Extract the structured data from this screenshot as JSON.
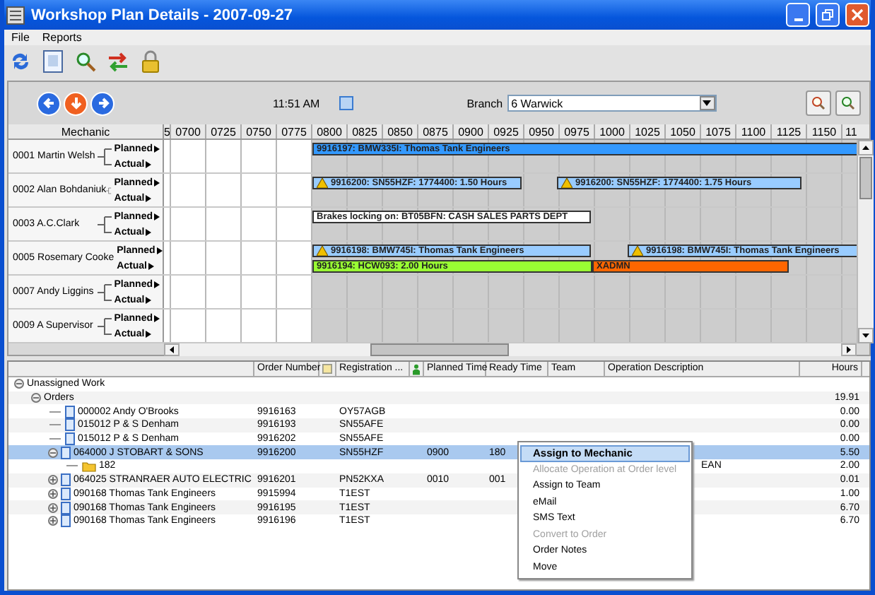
{
  "window": {
    "title": "Workshop Plan Details - 2007-09-27"
  },
  "menu": [
    "File",
    "Reports"
  ],
  "planner": {
    "time": "11:51 AM",
    "branch_label": "Branch",
    "branch": "6 Warwick",
    "mechanic_header": "Mechanic",
    "ticks": [
      "5",
      "0700",
      "0725",
      "0750",
      "0775",
      "0800",
      "0825",
      "0850",
      "0875",
      "0900",
      "0925",
      "0950",
      "0975",
      "1000",
      "1025",
      "1050",
      "1075",
      "1100",
      "1125",
      "1150",
      "11"
    ],
    "mechanics": [
      {
        "name": "0001 Martin Welsh",
        "lanes": [
          {
            "label": "Planned",
            "bars": [
              {
                "text": "9916197: BMW335I: Thomas Tank Engineers",
                "color": "#3399ff",
                "warning": false
              }
            ]
          },
          {
            "label": "Actual"
          }
        ]
      },
      {
        "name": "0002 Alan Bohdaniuk",
        "lanes": [
          {
            "label": "Planned",
            "bars": [
              {
                "text": "9916200: SN55HZF: 1774400: 1.50 Hours",
                "color": "#99ccff",
                "warning": true
              },
              {
                "text": "9916200: SN55HZF: 1774400: 1.75 Hours",
                "color": "#99ccff",
                "warning": true
              }
            ]
          },
          {
            "label": "Actual"
          }
        ]
      },
      {
        "name": "0003 A.C.Clark",
        "lanes": [
          {
            "label": "Planned",
            "bars": [
              {
                "text": "Brakes locking on: BT05BFN: CASH SALES PARTS DEPT",
                "color": "#ffffff",
                "warning": false
              }
            ]
          },
          {
            "label": "Actual"
          }
        ]
      },
      {
        "name": "0005 Rosemary Cooke",
        "lanes": [
          {
            "label": "Planned",
            "bars": [
              {
                "text": "9916198: BMW745I: Thomas Tank Engineers",
                "color": "#99ccff",
                "warning": true
              },
              {
                "text": "9916198: BMW745I: Thomas Tank Engineers",
                "color": "#99ccff",
                "warning": true
              }
            ]
          },
          {
            "label": "Actual",
            "bars": [
              {
                "text": "9916194: HCW093: 2.00 Hours",
                "color": "#99ff33",
                "warning": false
              },
              {
                "text": "XADMN",
                "color": "#ff6600",
                "warning": false
              }
            ]
          }
        ]
      },
      {
        "name": "0007 Andy Liggins",
        "lanes": [
          {
            "label": "Planned"
          },
          {
            "label": "Actual"
          }
        ]
      },
      {
        "name": "0009 A Supervisor",
        "lanes": [
          {
            "label": "Planned"
          },
          {
            "label": "Actual"
          }
        ]
      }
    ]
  },
  "work_list": {
    "columns": [
      {
        "kind": "text",
        "label": "Order Number"
      },
      {
        "kind": "icon"
      },
      {
        "kind": "text",
        "label": "Registration ..."
      },
      {
        "kind": "icon"
      },
      {
        "kind": "text",
        "label": "Planned Time"
      },
      {
        "kind": "text",
        "label": "Ready Time"
      },
      {
        "kind": "text",
        "label": "Team"
      },
      {
        "kind": "text",
        "label": "Operation Description"
      },
      {
        "kind": "text",
        "label": "Hours"
      }
    ],
    "rows": [
      {
        "label": "Unassigned Work",
        "expanded": true,
        "selected": false,
        "children": [
          {
            "label": "Orders",
            "hours": "19.91",
            "expanded": true,
            "selected": false,
            "children": [
              {
                "kind": "order",
                "label": "000002 Andy O'Brooks",
                "order_number": "9916163",
                "registration": "OY57AGB",
                "hours": "0.00",
                "selected": false
              },
              {
                "kind": "order",
                "label": "015012 P & S Denham",
                "order_number": "9916193",
                "registration": "SN55AFE",
                "hours": "0.00",
                "selected": false
              },
              {
                "kind": "order",
                "label": "015012 P & S Denham",
                "order_number": "9916202",
                "registration": "SN55AFE",
                "hours": "0.00",
                "selected": false
              },
              {
                "kind": "order",
                "label": "064000 J STOBART & SONS",
                "order_number": "9916200",
                "registration": "SN55HZF",
                "planned_time": "0900",
                "ready_time": "180",
                "hours": "5.50",
                "selected": true,
                "expanded": true,
                "children": [
                  {
                    "kind": "operation",
                    "label": "182",
                    "operation": "EAN",
                    "hours": "2.00",
                    "selected": false
                  }
                ]
              },
              {
                "kind": "order",
                "label": "064025 STRANRAER AUTO ELECTRIC",
                "order_number": "9916201",
                "registration": "PN52KXA",
                "planned_time": "0010",
                "ready_time": "001",
                "hours": "0.01",
                "selected": false,
                "expanded": false
              },
              {
                "kind": "order",
                "label": "090168 Thomas Tank Engineers",
                "order_number": "9915994",
                "registration": "T1EST",
                "hours": "1.00",
                "selected": false,
                "expanded": false
              },
              {
                "kind": "order",
                "label": "090168 Thomas Tank Engineers",
                "order_number": "9916195",
                "registration": "T1EST",
                "hours": "6.70",
                "selected": false,
                "expanded": false
              },
              {
                "kind": "order",
                "label": "090168 Thomas Tank Engineers",
                "order_number": "9916196",
                "registration": "T1EST",
                "hours": "6.70",
                "selected": false,
                "expanded": false
              }
            ]
          }
        ]
      }
    ]
  },
  "context_menu": [
    {
      "label": "Assign to Mechanic",
      "default": true,
      "selected": true,
      "disabled": false
    },
    {
      "label": "Allocate Operation at Order level",
      "default": false,
      "selected": false,
      "disabled": true
    },
    {
      "label": "Assign to Team",
      "default": false,
      "selected": false,
      "disabled": false
    },
    {
      "label": "eMail",
      "default": false,
      "selected": false,
      "disabled": false
    },
    {
      "label": "SMS Text",
      "default": false,
      "selected": false,
      "disabled": false
    },
    {
      "label": "Convert to Order",
      "default": false,
      "selected": false,
      "disabled": true
    },
    {
      "label": "Order Notes",
      "default": false,
      "selected": false,
      "disabled": false
    },
    {
      "label": "Move",
      "default": false,
      "selected": false,
      "disabled": false
    }
  ]
}
